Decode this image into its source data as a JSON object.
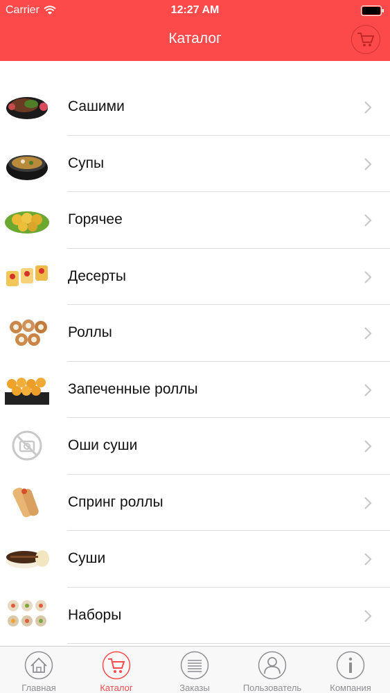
{
  "status_bar": {
    "carrier": "Carrier",
    "time": "12:27 AM"
  },
  "header": {
    "title": "Каталог",
    "cart_icon": "cart-icon",
    "color": "#fc4a4b"
  },
  "catalog": {
    "items": [
      {
        "label": "Сашими",
        "image": "sashimi"
      },
      {
        "label": "Супы",
        "image": "soup"
      },
      {
        "label": "Горячее",
        "image": "hot"
      },
      {
        "label": "Десерты",
        "image": "dessert"
      },
      {
        "label": "Роллы",
        "image": "rolls"
      },
      {
        "label": "Запеченные роллы",
        "image": "baked-rolls"
      },
      {
        "label": "Оши суши",
        "image": "no-photo"
      },
      {
        "label": "Спринг роллы",
        "image": "spring-rolls"
      },
      {
        "label": "Суши",
        "image": "sushi"
      },
      {
        "label": "Наборы",
        "image": "sets"
      }
    ]
  },
  "tabbar": {
    "tabs": [
      {
        "label": "Главная",
        "icon": "home-icon",
        "active": false
      },
      {
        "label": "Каталог",
        "icon": "cart-icon",
        "active": true
      },
      {
        "label": "Заказы",
        "icon": "list-icon",
        "active": false
      },
      {
        "label": "Пользователь",
        "icon": "user-icon",
        "active": false
      },
      {
        "label": "Компания",
        "icon": "info-icon",
        "active": false
      }
    ]
  },
  "colors": {
    "accent": "#fc4a4b",
    "separator": "#dcdcdc",
    "inactive": "#8e8e93"
  }
}
